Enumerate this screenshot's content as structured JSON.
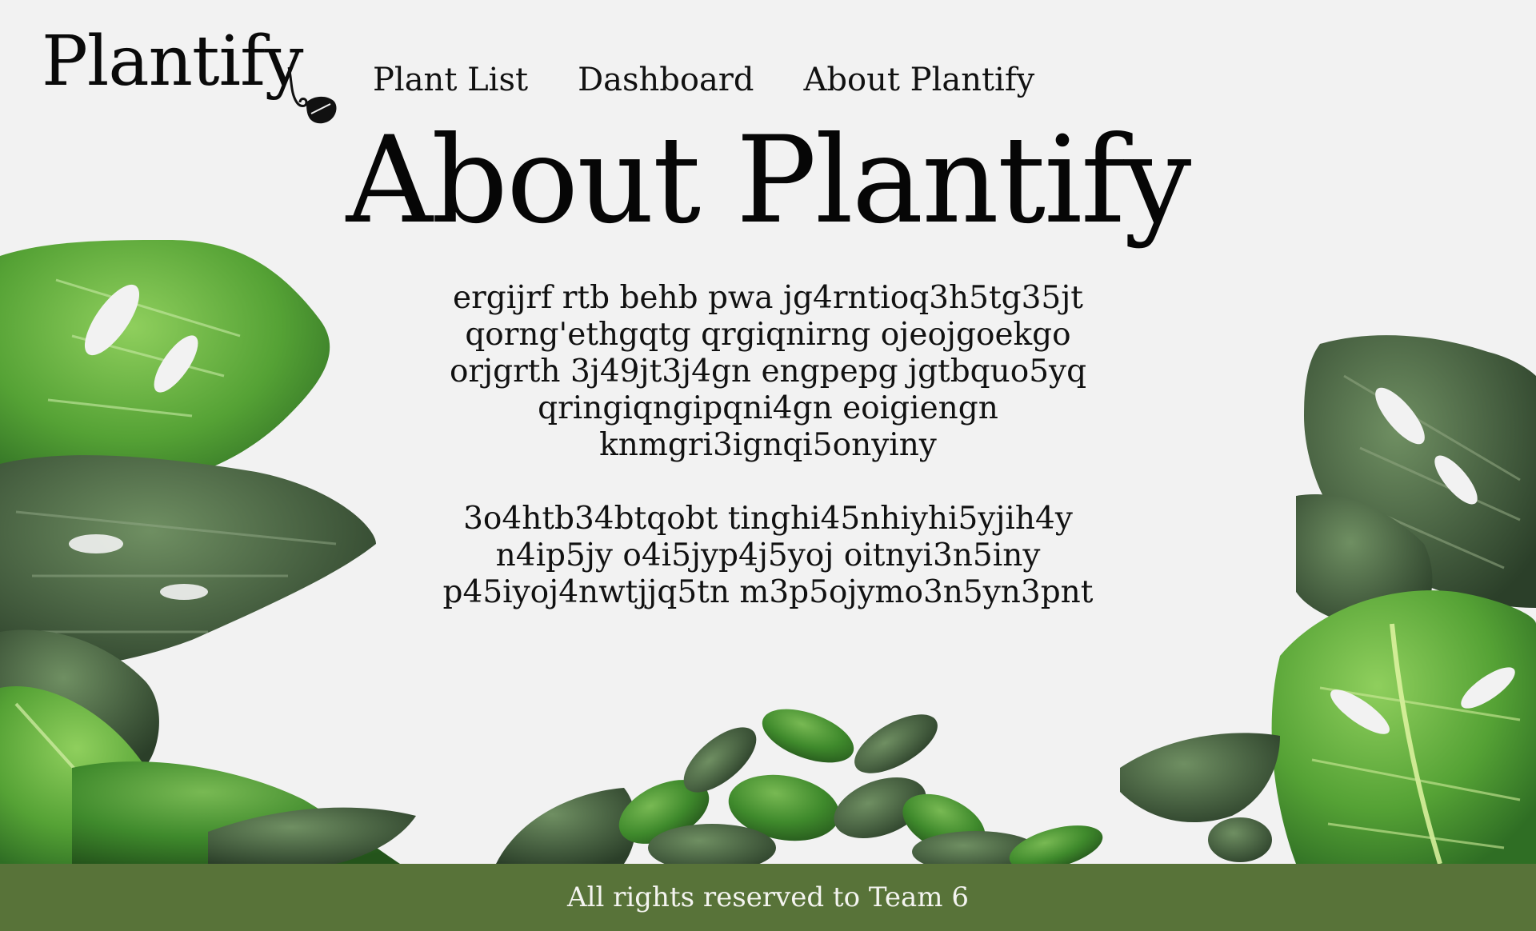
{
  "brand": {
    "name": "Plantify"
  },
  "nav": {
    "items": [
      {
        "label": "Plant List"
      },
      {
        "label": "Dashboard"
      },
      {
        "label": "About Plantify"
      }
    ]
  },
  "main": {
    "title": "About Plantify",
    "paragraphs": [
      "ergijrf rtb behb pwa jg4rntioq3h5tg35jt qorng'ethgqtg qrgiqnirng ojeojgoekgo orjgrth 3j49jt3j4gn engpepg jgtbquo5yq qringiqngipqni4gn eoigiengn knmgri3ignqi5onyiny",
      "3o4htb34btqobt tinghi45nhiyhi5yjih4y n4ip5jy o4i5jyp4j5yoj oitnyi3n5iny p45iyoj4nwtjjq5tn m3p5ojymo3n5yn3pnt"
    ]
  },
  "footer": {
    "text": "All rights reserved to Team 6"
  },
  "colors": {
    "background": "#f2f2f2",
    "footer": "#587339",
    "footer_text": "#f4f4f0",
    "leaf_light": "#5fa83c",
    "leaf_dark": "#3f6a3a"
  },
  "icons": {
    "logo_vine": "leaf-vine-icon",
    "decoration": "monstera-leaves"
  }
}
